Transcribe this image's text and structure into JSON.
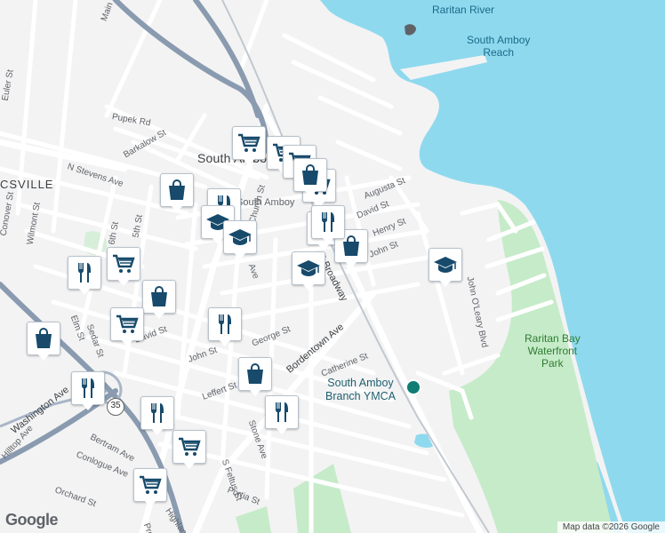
{
  "map": {
    "colors": {
      "land": "#f3f3f4",
      "water": "#8fd9ee",
      "park": "#c6ebc9",
      "road": "#ffffff",
      "highway": "#8a9bb0",
      "pin_icon": "#174a6b"
    },
    "water_labels": {
      "river": "Raritan River",
      "reach": "South Amboy\nReach"
    },
    "place_labels": {
      "town": "South Amboy",
      "district": "CSVILLE"
    },
    "park_labels": {
      "waterfront": "Raritan Bay\nWaterfront\nPark"
    },
    "poi_labels": {
      "ymca": "South Amboy\nBranch YMCA"
    },
    "route_shield": "35",
    "streets": [
      "Main St",
      "Euler St",
      "Pupek Rd",
      "Barkalow St",
      "N Stevens Ave",
      "Conover St",
      "Wilmont St",
      "6th St",
      "5th St",
      "Elm St",
      "Sedar St",
      "David St",
      "John St",
      "George St",
      "Leffert St",
      "Bordentown Ave",
      "S Broadway",
      "Catherine St",
      "Washington Ave",
      "Hilltop Ave",
      "Bertram Ave",
      "Conlogue Ave",
      "Orchard St",
      "Highland",
      "S Feltus St",
      "Portia St",
      "Stone Ave",
      "John O'Leary Blvd",
      "Augusta St",
      "Henry St",
      "David St",
      "John St",
      "Church St",
      "South Amboy",
      "Ave",
      "Prospect"
    ],
    "footer": {
      "logo": "Google",
      "attribution": "Map data ©2026 Google"
    }
  },
  "pins": [
    {
      "type": "grocery",
      "icon": "cart-icon"
    },
    {
      "type": "grocery",
      "icon": "cart-icon"
    },
    {
      "type": "grocery",
      "icon": "cart-icon"
    },
    {
      "type": "shopping",
      "icon": "shopping-bag-icon"
    },
    {
      "type": "restaurant",
      "icon": "fork-knife-icon"
    },
    {
      "type": "school",
      "icon": "graduation-cap-icon"
    },
    {
      "type": "school",
      "icon": "graduation-cap-icon"
    },
    {
      "type": "restaurant",
      "icon": "fork-knife-icon"
    },
    {
      "type": "grocery",
      "icon": "cart-icon"
    },
    {
      "type": "shopping",
      "icon": "shopping-bag-icon"
    },
    {
      "type": "school",
      "icon": "graduation-cap-icon"
    },
    {
      "type": "school",
      "icon": "graduation-cap-icon"
    },
    {
      "type": "restaurant",
      "icon": "fork-knife-icon"
    },
    {
      "type": "grocery",
      "icon": "cart-icon"
    },
    {
      "type": "shopping",
      "icon": "shopping-bag-icon"
    },
    {
      "type": "grocery",
      "icon": "cart-icon"
    },
    {
      "type": "shopping",
      "icon": "shopping-bag-icon"
    },
    {
      "type": "restaurant",
      "icon": "fork-knife-icon"
    },
    {
      "type": "shopping",
      "icon": "shopping-bag-icon"
    },
    {
      "type": "restaurant",
      "icon": "fork-knife-icon"
    },
    {
      "type": "restaurant",
      "icon": "fork-knife-icon"
    },
    {
      "type": "restaurant",
      "icon": "fork-knife-icon"
    },
    {
      "type": "grocery",
      "icon": "cart-icon"
    },
    {
      "type": "grocery",
      "icon": "cart-icon"
    },
    {
      "type": "restaurant",
      "icon": "fork-knife-icon"
    },
    {
      "type": "shopping",
      "icon": "shopping-bag-icon"
    }
  ]
}
